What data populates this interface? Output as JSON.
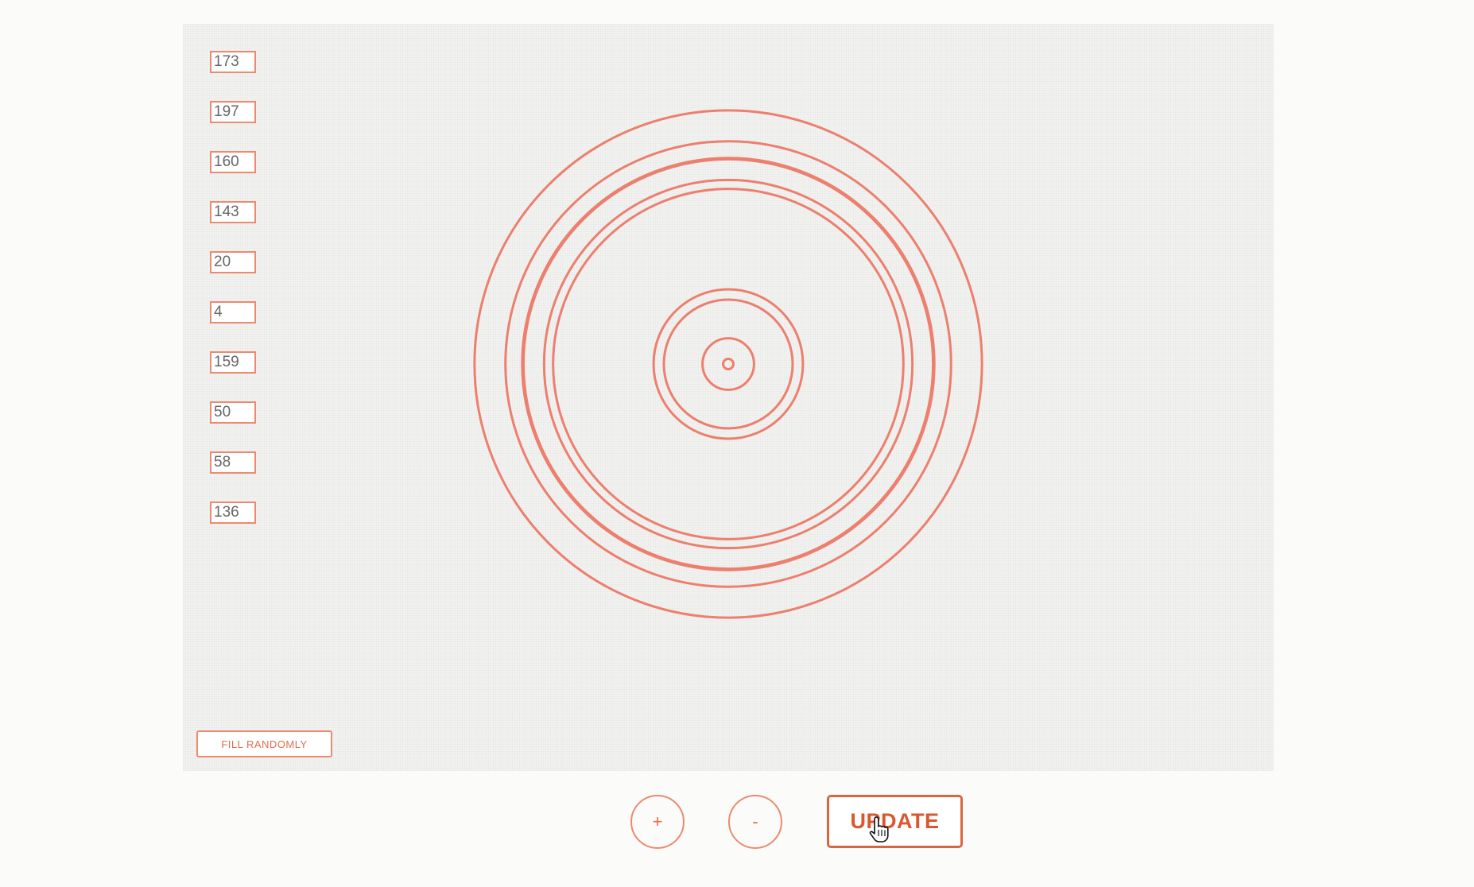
{
  "inputs": [
    {
      "value": "173"
    },
    {
      "value": "197"
    },
    {
      "value": "160"
    },
    {
      "value": "143"
    },
    {
      "value": "20"
    },
    {
      "value": "4"
    },
    {
      "value": "159"
    },
    {
      "value": "50"
    },
    {
      "value": "58"
    },
    {
      "value": "136"
    }
  ],
  "buttons": {
    "fill_randomly": "Fill randomly",
    "plus": "+",
    "minus": "-",
    "update": "UPDATE"
  },
  "rings": [
    {
      "value": 4
    },
    {
      "value": 20
    },
    {
      "value": 50
    },
    {
      "value": 58
    },
    {
      "value": 136
    },
    {
      "value": 143
    },
    {
      "value": 159
    },
    {
      "value": 160
    },
    {
      "value": 173
    },
    {
      "value": 197
    }
  ],
  "colors": {
    "accent": "#ec8a6f",
    "accent_dark": "#d9582f",
    "ring_stroke": "#ec7f6d",
    "panel_bg": "#f2f2f1",
    "page_bg": "#fbfbfa"
  },
  "icons": {
    "cursor": "hand-pointer-icon"
  }
}
